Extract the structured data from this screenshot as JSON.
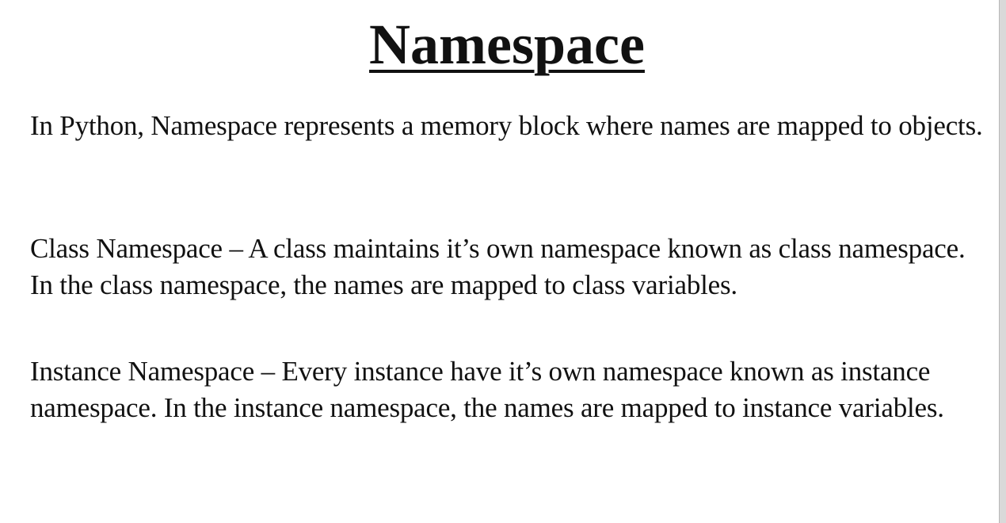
{
  "slide": {
    "title": "Namespace",
    "paragraphs": {
      "p1": "In Python, Namespace represents a memory block where names are mapped to objects.",
      "p2": "Class Namespace – A class maintains it’s own namespace known as class namespace. In the class namespace, the names are mapped to class variables.",
      "p3": "Instance Namespace – Every instance have it’s own namespace known as instance namespace. In the instance namespace, the names are mapped to instance variables."
    }
  },
  "colors": {
    "background": "#ffffff",
    "text": "#111111",
    "edge_bar": "#d9d9d9"
  }
}
